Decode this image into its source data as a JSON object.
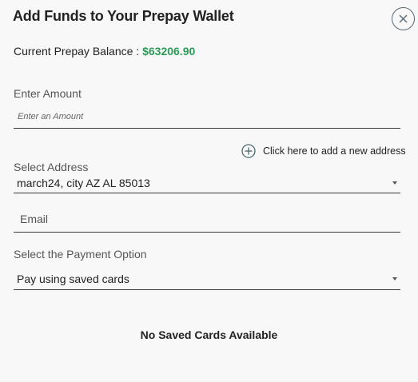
{
  "modal": {
    "title": "Add Funds to Your Prepay Wallet",
    "close_icon": "close-icon"
  },
  "balance": {
    "label": "Current Prepay Balance :",
    "amount": "$63206.90",
    "amount_color": "#2e9a58"
  },
  "amount": {
    "label": "Enter Amount",
    "placeholder": "Enter an Amount",
    "value": ""
  },
  "address": {
    "add_link": "Click here to add a new address",
    "add_icon": "plus-circle-icon",
    "label": "Select Address",
    "selected": "march24, city AZ AL 85013"
  },
  "email": {
    "placeholder": "Email",
    "value": ""
  },
  "payment": {
    "label": "Select the Payment Option",
    "selected": "Pay using saved cards"
  },
  "cards": {
    "empty_message": "No Saved Cards Available"
  }
}
